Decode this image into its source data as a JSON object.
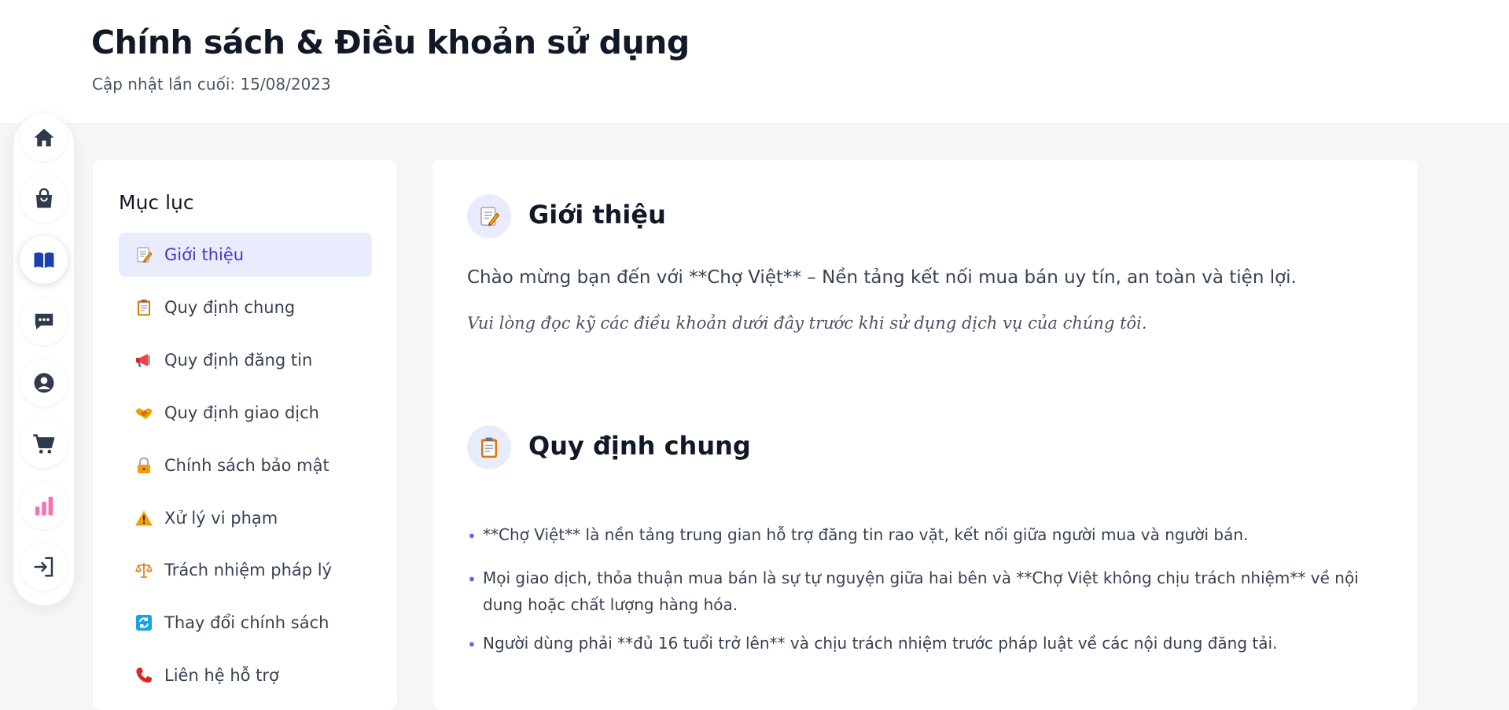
{
  "header": {
    "title": "Chính sách & Điều khoản sử dụng",
    "updated": "Cập nhật lần cuối: 15/08/2023"
  },
  "rail": {
    "items": [
      {
        "icon": "home-icon",
        "active": false
      },
      {
        "icon": "shopping-bag-icon",
        "active": false
      },
      {
        "icon": "book-icon",
        "active": true
      },
      {
        "icon": "chat-icon",
        "active": false
      },
      {
        "icon": "user-icon",
        "active": false
      },
      {
        "icon": "cart-icon",
        "active": false
      },
      {
        "icon": "chart-icon",
        "active": false
      },
      {
        "icon": "login-icon",
        "active": false
      }
    ]
  },
  "toc": {
    "title": "Mục lục",
    "items": [
      {
        "label": "Giới thiệu",
        "icon": "memo-icon",
        "active": true
      },
      {
        "label": "Quy định chung",
        "icon": "clipboard-icon"
      },
      {
        "label": "Quy định đăng tin",
        "icon": "megaphone-icon"
      },
      {
        "label": "Quy định giao dịch",
        "icon": "handshake-icon"
      },
      {
        "label": "Chính sách bảo mật",
        "icon": "lock-icon"
      },
      {
        "label": "Xử lý vi phạm",
        "icon": "warning-icon"
      },
      {
        "label": "Trách nhiệm pháp lý",
        "icon": "scales-icon"
      },
      {
        "label": "Thay đổi chính sách",
        "icon": "refresh-icon"
      },
      {
        "label": "Liên hệ hỗ trợ",
        "icon": "phone-icon"
      }
    ]
  },
  "sections": {
    "intro": {
      "title": "Giới thiệu",
      "icon": "memo-icon",
      "text": "Chào mừng bạn đến với **Chợ Việt** – Nền tảng kết nối mua bán uy tín, an toàn và tiện lợi.",
      "note": "Vui lòng đọc kỹ các điều khoản dưới đây trước khi sử dụng dịch vụ của chúng tôi."
    },
    "general": {
      "title": "Quy định chung",
      "icon": "clipboard-icon",
      "bullets": [
        "**Chợ Việt** là nền tảng trung gian hỗ trợ đăng tin rao vặt, kết nối giữa người mua và người bán.",
        "Mọi giao dịch, thỏa thuận mua bán là sự tự nguyện giữa hai bên và **Chợ Việt không chịu trách nhiệm** về nội dung hoặc chất lượng hàng hóa.",
        "Người dùng phải **đủ 16 tuổi trở lên** và chịu trách nhiệm trước pháp luật về các nội dung đăng tải."
      ]
    }
  },
  "colors": {
    "accent": "#4338ca",
    "accent_bg": "#e8ecfc",
    "rail_icon": "#2f3a4c",
    "book_icon": "#1e40af",
    "chart_icon": "#f472b6",
    "bullet": "#6366f1"
  }
}
